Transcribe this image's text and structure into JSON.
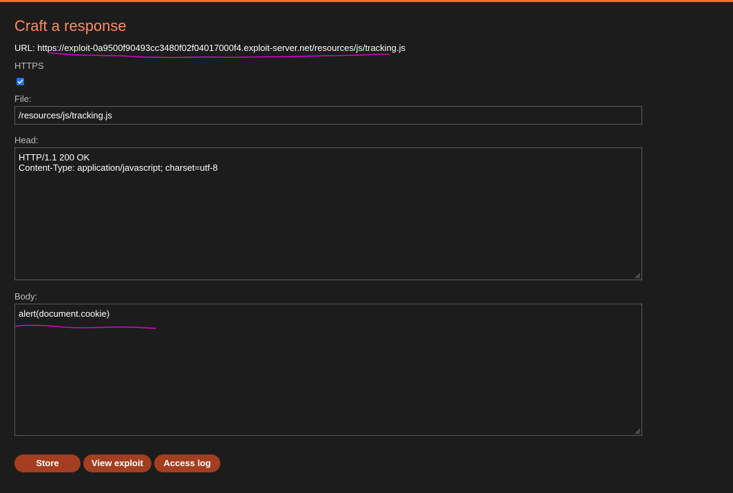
{
  "page": {
    "title": "Craft a response",
    "accent_color": "#ff6633",
    "title_color": "#ff8a5b",
    "button_color": "#a33e20",
    "annotation_color": "#e100e1"
  },
  "url": {
    "label": "URL:",
    "value": "https://exploit-0a9500f90493cc3480f02f04017000f4.exploit-server.net/resources/js/tracking.js"
  },
  "https": {
    "label": "HTTPS",
    "checked": true
  },
  "file": {
    "label": "File:",
    "value": "/resources/js/tracking.js"
  },
  "head": {
    "label": "Head:",
    "value": "HTTP/1.1 200 OK\nContent-Type: application/javascript; charset=utf-8"
  },
  "body": {
    "label": "Body:",
    "value": "alert(document.cookie)"
  },
  "buttons": {
    "store": "Store",
    "view_exploit": "View exploit",
    "access_log": "Access log"
  }
}
